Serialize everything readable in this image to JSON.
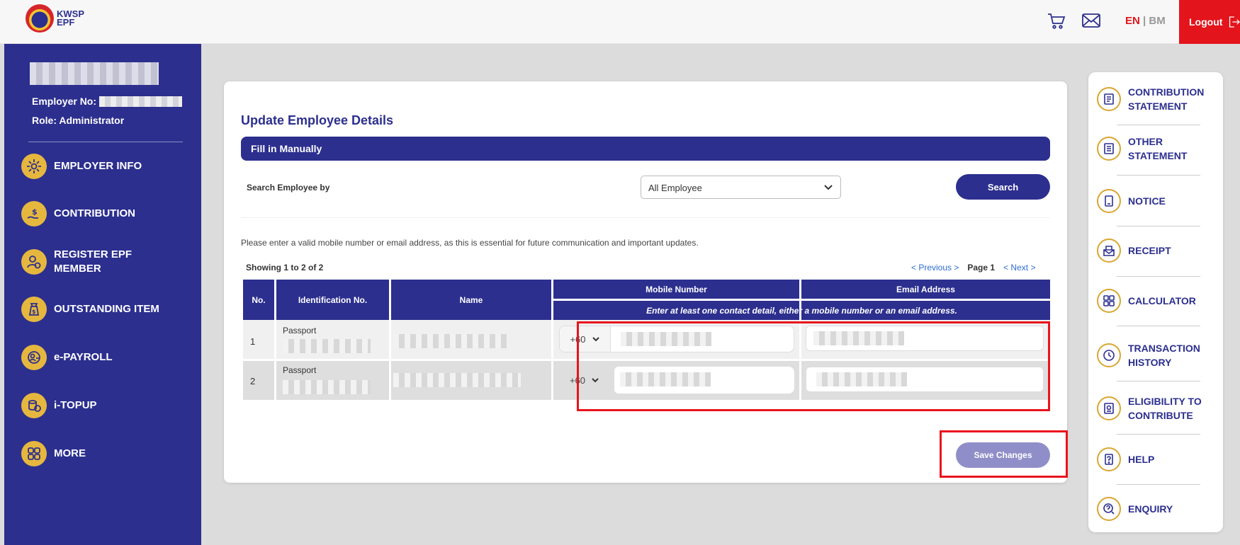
{
  "header": {
    "logo_line1": "KWSP",
    "logo_line2": "EPF",
    "lang_en": "EN",
    "lang_sep": " | ",
    "lang_bm": "BM",
    "logout_label": "Logout"
  },
  "sidebar": {
    "employer_no_label": "Employer No:",
    "role": "Role: Administrator",
    "items": [
      {
        "label": "EMPLOYER INFO",
        "icon": "gear-icon"
      },
      {
        "label": "CONTRIBUTION",
        "icon": "money-hand-icon"
      },
      {
        "label": "REGISTER EPF MEMBER",
        "icon": "user-add-icon"
      },
      {
        "label": "OUTSTANDING ITEM",
        "icon": "money-bag-icon"
      },
      {
        "label": "e-PAYROLL",
        "icon": "payroll-icon"
      },
      {
        "label": "i-TOPUP",
        "icon": "coins-icon"
      },
      {
        "label": "MORE",
        "icon": "grid-icon"
      }
    ]
  },
  "main": {
    "title": "Update Employee Details",
    "section_title": "Fill in Manually",
    "search_label": "Search Employee by",
    "search_select_value": "All Employee",
    "search_button": "Search",
    "notice": "Please enter a valid mobile number or email address, as this is essential for future communication and important updates.",
    "showing": "Showing 1 to 2 of 2",
    "pager": {
      "previous": "< Previous >",
      "page_label": "Page",
      "page_number": "1",
      "next": "< Next >"
    },
    "table": {
      "headers": {
        "no": "No.",
        "id": "Identification No.",
        "name": "Name",
        "mobile": "Mobile Number",
        "email": "Email Address"
      },
      "contact_note": "Enter at least one contact detail, either a mobile number or an email address.",
      "rows": [
        {
          "no": "1",
          "id_type": "Passport",
          "country_code": "+60"
        },
        {
          "no": "2",
          "id_type": "Passport",
          "country_code": "+60"
        }
      ]
    },
    "save_button": "Save Changes"
  },
  "right_sidebar": {
    "items": [
      {
        "label": "CONTRIBUTION STATEMENT",
        "icon": "statement-icon"
      },
      {
        "label": "OTHER STATEMENT",
        "icon": "document-icon"
      },
      {
        "label": "NOTICE",
        "icon": "notice-icon"
      },
      {
        "label": "RECEIPT",
        "icon": "receipt-icon"
      },
      {
        "label": "CALCULATOR",
        "icon": "calculator-icon"
      },
      {
        "label": "TRANSACTION HISTORY",
        "icon": "history-icon"
      },
      {
        "label": "ELIGIBILITY TO CONTRIBUTE",
        "icon": "eligibility-icon"
      },
      {
        "label": "HELP",
        "icon": "help-icon"
      },
      {
        "label": "ENQUIRY",
        "icon": "enquiry-icon"
      }
    ]
  },
  "colors": {
    "primary": "#2c2f8e",
    "accent_red": "#e3141c",
    "gold": "#e6b73e",
    "save_disabled": "#8f8ec8"
  }
}
